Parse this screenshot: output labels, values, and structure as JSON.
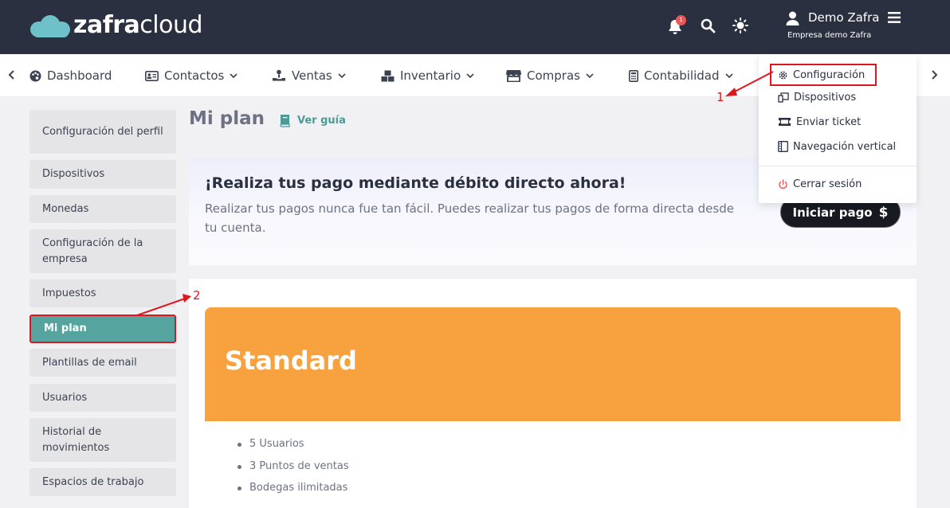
{
  "brand": {
    "logo_prefix": "zafra",
    "logo_suffix": "cloud",
    "accent": "#56a4a0",
    "dark": "#2b3041"
  },
  "header": {
    "notification_count": "1",
    "user_name": "Demo Zafra",
    "company": "Empresa demo Zafra",
    "icons": [
      "bell-icon",
      "search-icon",
      "sun-icon",
      "user-icon",
      "hamburger-icon"
    ]
  },
  "nav": {
    "items": [
      {
        "label": "Dashboard",
        "icon": "palette-icon"
      },
      {
        "label": "Contactos",
        "icon": "id-card-icon"
      },
      {
        "label": "Ventas",
        "icon": "hand-coin-icon"
      },
      {
        "label": "Inventario",
        "icon": "boxes-icon"
      },
      {
        "label": "Compras",
        "icon": "store-icon"
      },
      {
        "label": "Contabilidad",
        "icon": "calculator-icon"
      }
    ]
  },
  "user_menu": {
    "items": [
      {
        "label": "Configuración",
        "icon": "gear-icon"
      },
      {
        "label": "Dispositivos",
        "icon": "devices-icon"
      },
      {
        "label": "Enviar ticket",
        "icon": "ticket-icon"
      },
      {
        "label": "Navegación vertical",
        "icon": "sidebar-layout-icon"
      }
    ],
    "logout": {
      "label": "Cerrar sesión",
      "icon": "power-icon"
    }
  },
  "sidebar": {
    "items": [
      {
        "label": "Configuración del perfil"
      },
      {
        "label": "Dispositivos"
      },
      {
        "label": "Monedas"
      },
      {
        "label": "Configuración de la empresa"
      },
      {
        "label": "Impuestos"
      },
      {
        "label": "Mi plan",
        "active": true
      },
      {
        "label": "Plantillas de email"
      },
      {
        "label": "Usuarios"
      },
      {
        "label": "Historial de movimientos"
      },
      {
        "label": "Espacios de trabajo"
      }
    ]
  },
  "main": {
    "title": "Mi plan",
    "guide_label": "Ver guía",
    "banner": {
      "title": "¡Realiza tus pago mediante débito directo ahora!",
      "text": "Realizar tus pagos nunca fue tan fácil. Puedes realizar tus pagos de forma directa desde tu cuenta.",
      "button_label": "Iniciar pago"
    },
    "plan": {
      "name": "Standard",
      "color": "#f8a13f",
      "features": [
        "5 Usuarios",
        "3 Puntos de ventas",
        "Bodegas ilimitadas"
      ]
    }
  },
  "annotations": {
    "first": "1",
    "second": "2"
  }
}
